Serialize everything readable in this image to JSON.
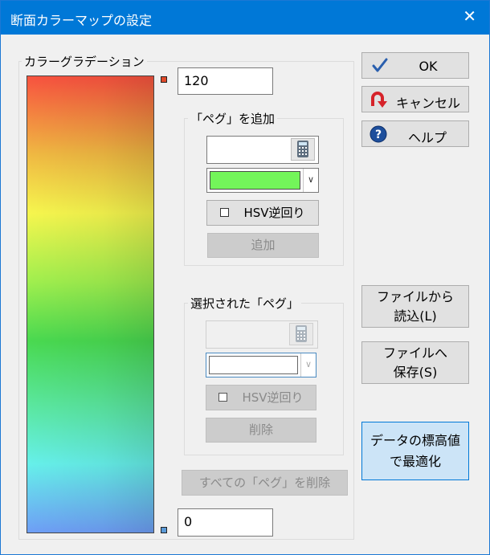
{
  "window": {
    "title": "断面カラーマップの設定",
    "close_glyph": "✕"
  },
  "gradation": {
    "label": "カラーグラデーション",
    "top_value": "120",
    "bottom_value": "0",
    "top_peg_color": "#e04a2a",
    "bottom_peg_color": "#5a9ad8"
  },
  "add_peg": {
    "label": "「ペグ」を追加",
    "value": "",
    "color": "#73f55a",
    "hsv_label": "HSV逆回り",
    "add_button": "追加"
  },
  "selected_peg": {
    "label": "選択された「ペグ」",
    "value": "",
    "color": "",
    "hsv_label": "HSV逆回り",
    "delete_button": "削除"
  },
  "delete_all_button": "すべての「ペグ」を削除",
  "buttons": {
    "ok": "OK",
    "cancel": "キャンセル",
    "help": "ヘルプ",
    "load_line1": "ファイルから",
    "load_line2": "読込(L)",
    "save_line1": "ファイルへ",
    "save_line2": "保存(S)",
    "optimize_line1": "データの標高値",
    "optimize_line2": "で最適化"
  }
}
